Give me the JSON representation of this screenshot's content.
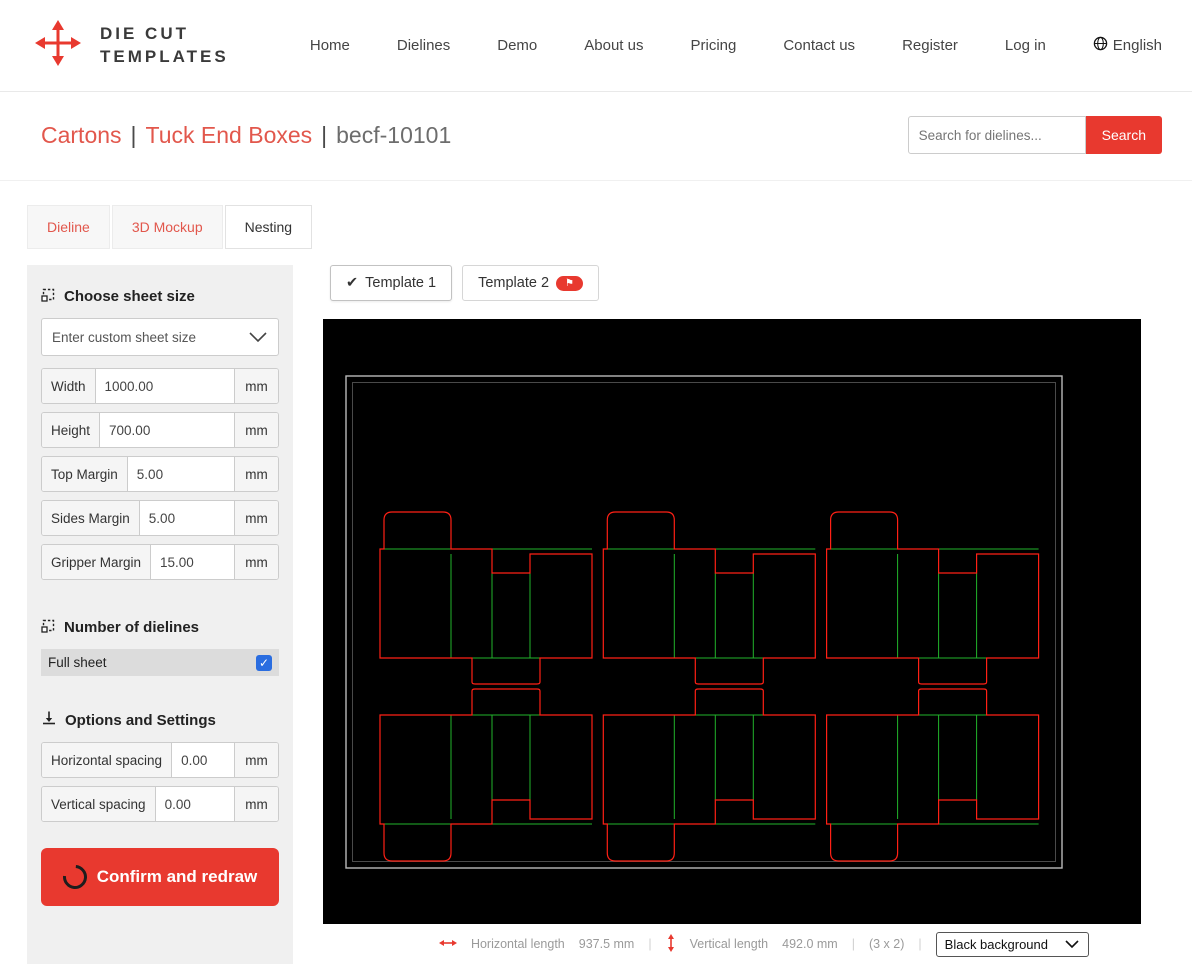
{
  "brand": {
    "line1": "DIE CUT",
    "line2": "TEMPLATES"
  },
  "nav": {
    "items": [
      "Home",
      "Dielines",
      "Demo",
      "About us",
      "Pricing",
      "Contact us",
      "Register",
      "Log in"
    ],
    "language": "English"
  },
  "breadcrumb": {
    "category": "Cartons",
    "subcategory": "Tuck End Boxes",
    "code": "becf-10101",
    "separator": "|"
  },
  "search": {
    "placeholder": "Search for dielines...",
    "button": "Search"
  },
  "view_tabs": {
    "dieline": "Dieline",
    "mockup": "3D Mockup",
    "nesting": "Nesting"
  },
  "sidebar": {
    "sheet_size": {
      "title": "Choose sheet size",
      "dropdown_value": "Enter custom sheet size",
      "fields": [
        {
          "label": "Width",
          "value": "1000.00",
          "unit": "mm"
        },
        {
          "label": "Height",
          "value": "700.00",
          "unit": "mm"
        },
        {
          "label": "Top Margin",
          "value": "5.00",
          "unit": "mm"
        },
        {
          "label": "Sides Margin",
          "value": "5.00",
          "unit": "mm"
        },
        {
          "label": "Gripper Margin",
          "value": "15.00",
          "unit": "mm"
        }
      ]
    },
    "dielines": {
      "title": "Number of dielines",
      "full_sheet_label": "Full sheet",
      "full_sheet_checked": true,
      "check_glyph": "✓"
    },
    "options": {
      "title": "Options and Settings",
      "fields": [
        {
          "label": "Horizontal spacing",
          "value": "0.00",
          "unit": "mm"
        },
        {
          "label": "Vertical spacing",
          "value": "0.00",
          "unit": "mm"
        }
      ]
    },
    "confirm_button": "Confirm and redraw"
  },
  "canvas": {
    "template_tabs": [
      {
        "label": "Template 1",
        "check": "✔",
        "active": true
      },
      {
        "label": "Template 2",
        "badge": "⚑"
      }
    ],
    "status": {
      "horizontal_label": "Horizontal length",
      "horizontal_value": "937.5 mm",
      "vertical_label": "Vertical length",
      "vertical_value": "492.0 mm",
      "grid": "(3 x 2)",
      "separator": "|",
      "background_select": "Black background"
    },
    "nesting": {
      "columns": 3,
      "rows": 2,
      "colors": {
        "background": "#000000",
        "cut": "#ff2015",
        "crease": "#22b32b",
        "sheet_border": "#b9b9b9",
        "sheet_inner": "#4a4a4a"
      }
    }
  },
  "colors": {
    "accent": "#e8392f"
  }
}
